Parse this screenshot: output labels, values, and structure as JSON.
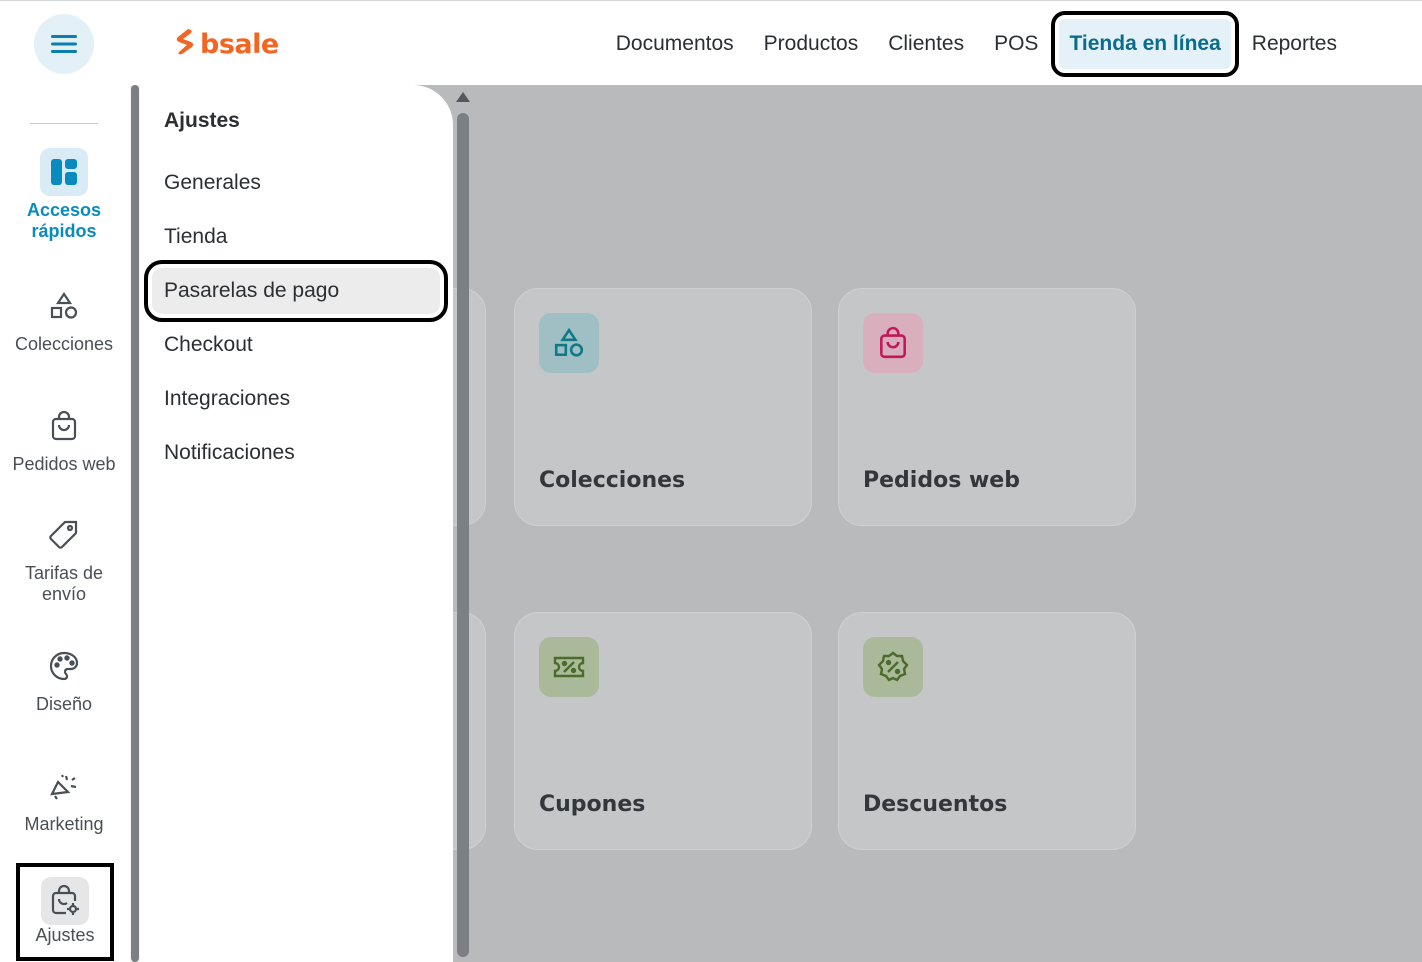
{
  "header": {
    "menu_icon": "hamburger-icon",
    "logo_text": "bsale",
    "brand_color": "#f26522",
    "nav": [
      {
        "label": "Documentos"
      },
      {
        "label": "Productos"
      },
      {
        "label": "Clientes"
      },
      {
        "label": "POS"
      },
      {
        "label": "Tienda en línea",
        "active": true
      },
      {
        "label": "Reportes"
      }
    ]
  },
  "sidebar": {
    "items": [
      {
        "label_line1": "Accesos",
        "label_line2": "rápidos",
        "icon": "dashboard-icon",
        "active": true
      },
      {
        "label": "Colecciones",
        "icon": "shapes-icon"
      },
      {
        "label": "Pedidos web",
        "icon": "shopping-bag-icon"
      },
      {
        "label_line1": "Tarifas de",
        "label_line2": "envío",
        "icon": "tag-icon"
      },
      {
        "label": "Diseño",
        "icon": "palette-icon"
      },
      {
        "label": "Marketing",
        "icon": "megaphone-icon"
      },
      {
        "label": "Ajustes",
        "icon": "bag-settings-icon",
        "selected": true
      }
    ]
  },
  "settings_panel": {
    "title": "Ajustes",
    "items": [
      {
        "label": "Generales"
      },
      {
        "label": "Tienda"
      },
      {
        "label": "Pasarelas de pago",
        "selected": true
      },
      {
        "label": "Checkout"
      },
      {
        "label": "Integraciones"
      },
      {
        "label": "Notificaciones"
      }
    ]
  },
  "cards": [
    {
      "title": "Colecciones",
      "icon": "shapes-icon",
      "color": "#0d7a86"
    },
    {
      "title": "Pedidos web",
      "icon": "shopping-bag-icon",
      "color": "#c2185b"
    },
    {
      "title": "Cupones",
      "icon": "ticket-percent-icon",
      "color": "#4c6b2a"
    },
    {
      "title": "Descuentos",
      "icon": "badge-percent-icon",
      "color": "#4c6b2a"
    }
  ]
}
